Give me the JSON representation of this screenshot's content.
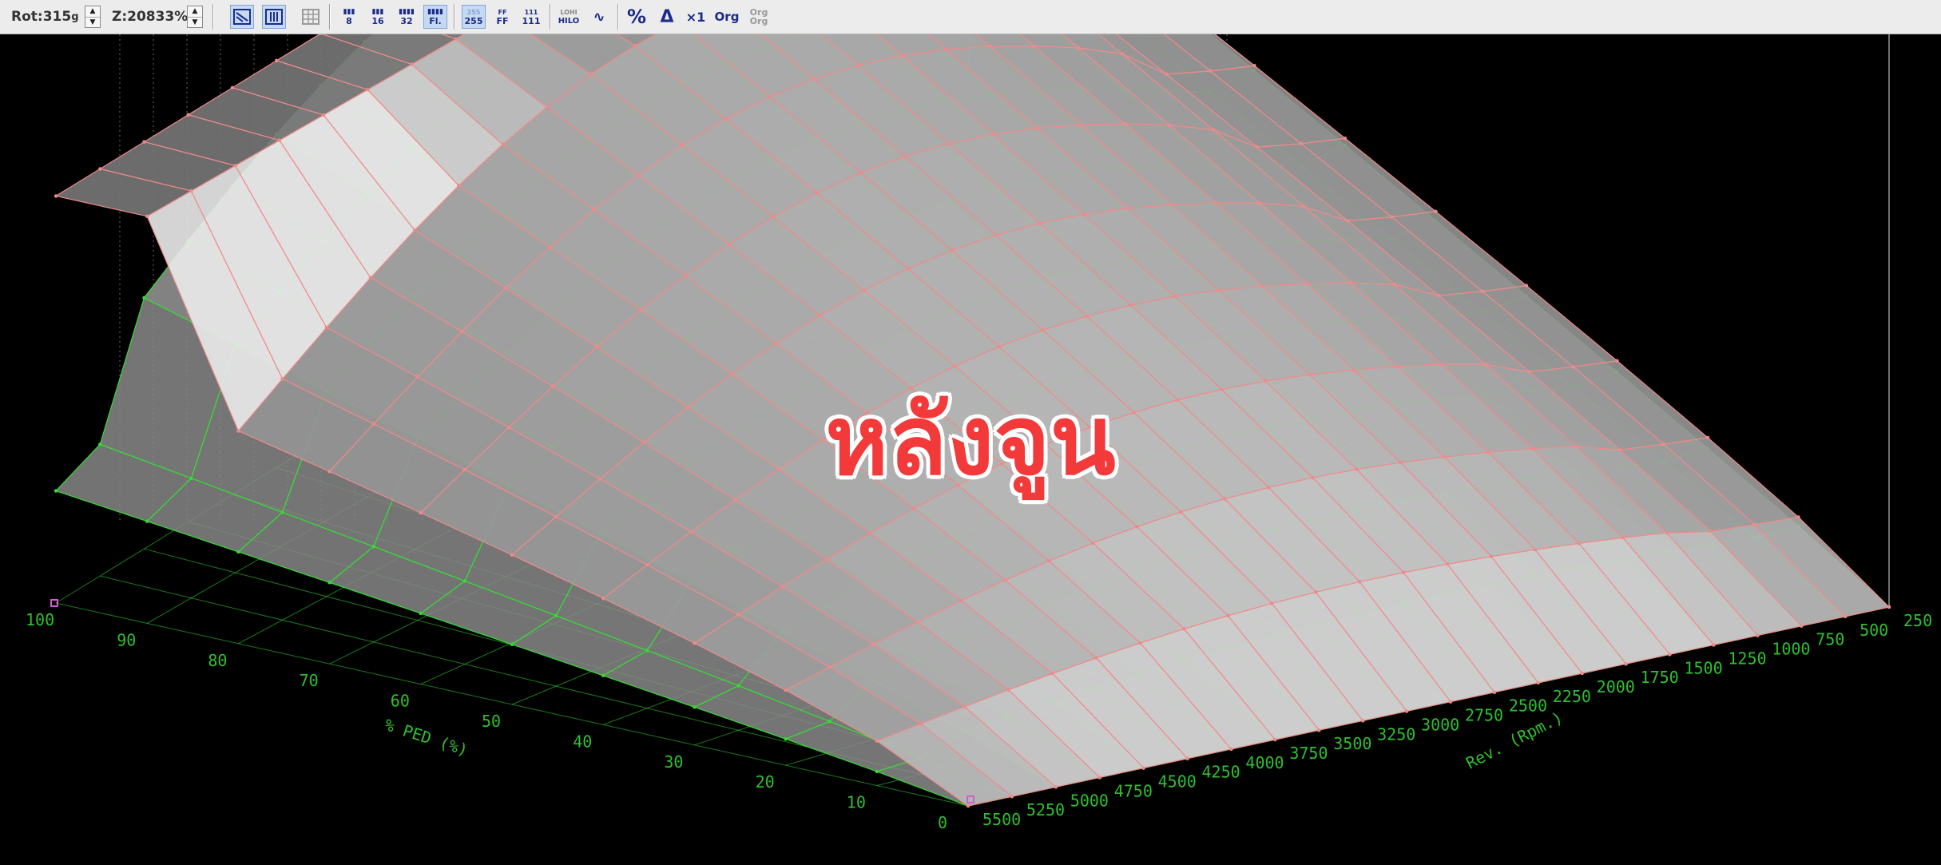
{
  "toolbar": {
    "rotation_label": "Rot:315",
    "rotation_unit": "g",
    "zoom_label": "Z:20833%",
    "buttons": {
      "resolution_8": "8",
      "resolution_16": "16",
      "resolution_32": "32",
      "resolution_fl": "Fl.",
      "format_255": "255",
      "format_ff": "FF",
      "format_111": "111",
      "lohi_top": "LOHI",
      "lohi_bottom": "HILO",
      "wave": "∿",
      "percent": "%",
      "delta": "Δ",
      "times_one": "×1",
      "org": "Org",
      "org_org_top": "Org",
      "org_org_bottom": "Org"
    }
  },
  "overlay_text": "หลังจูน",
  "axes": {
    "ped_label": "% PED (%)",
    "rev_label": "Rev. (Rpm.)",
    "ped_ticks": [
      "100",
      "90",
      "80",
      "70",
      "60",
      "50",
      "40",
      "30",
      "20",
      "10",
      "0"
    ],
    "rev_ticks": [
      "250",
      "500",
      "750",
      "1000",
      "1250",
      "1500",
      "1750",
      "2000",
      "2250",
      "2500",
      "2750",
      "3000",
      "3250",
      "3500",
      "3750",
      "4000",
      "4250",
      "4500",
      "4750",
      "5000",
      "5250",
      "5500"
    ]
  },
  "colors": {
    "background": "#000000",
    "grid_current": "#f08a8a",
    "grid_original": "#33dd33",
    "overlay": "#f23a3a"
  },
  "chart_data": {
    "type": "surface-3d",
    "title": "",
    "xlabel": "Rev. (Rpm.)",
    "ylabel": "% PED (%)",
    "x": [
      250,
      500,
      750,
      1000,
      1250,
      1500,
      1750,
      2000,
      2250,
      2500,
      2750,
      3000,
      3250,
      3500,
      3750,
      4000,
      4250,
      4500,
      4750,
      5000,
      5250,
      5500
    ],
    "y": [
      0,
      10,
      20,
      30,
      40,
      50,
      60,
      70,
      80,
      90,
      100
    ]
  }
}
